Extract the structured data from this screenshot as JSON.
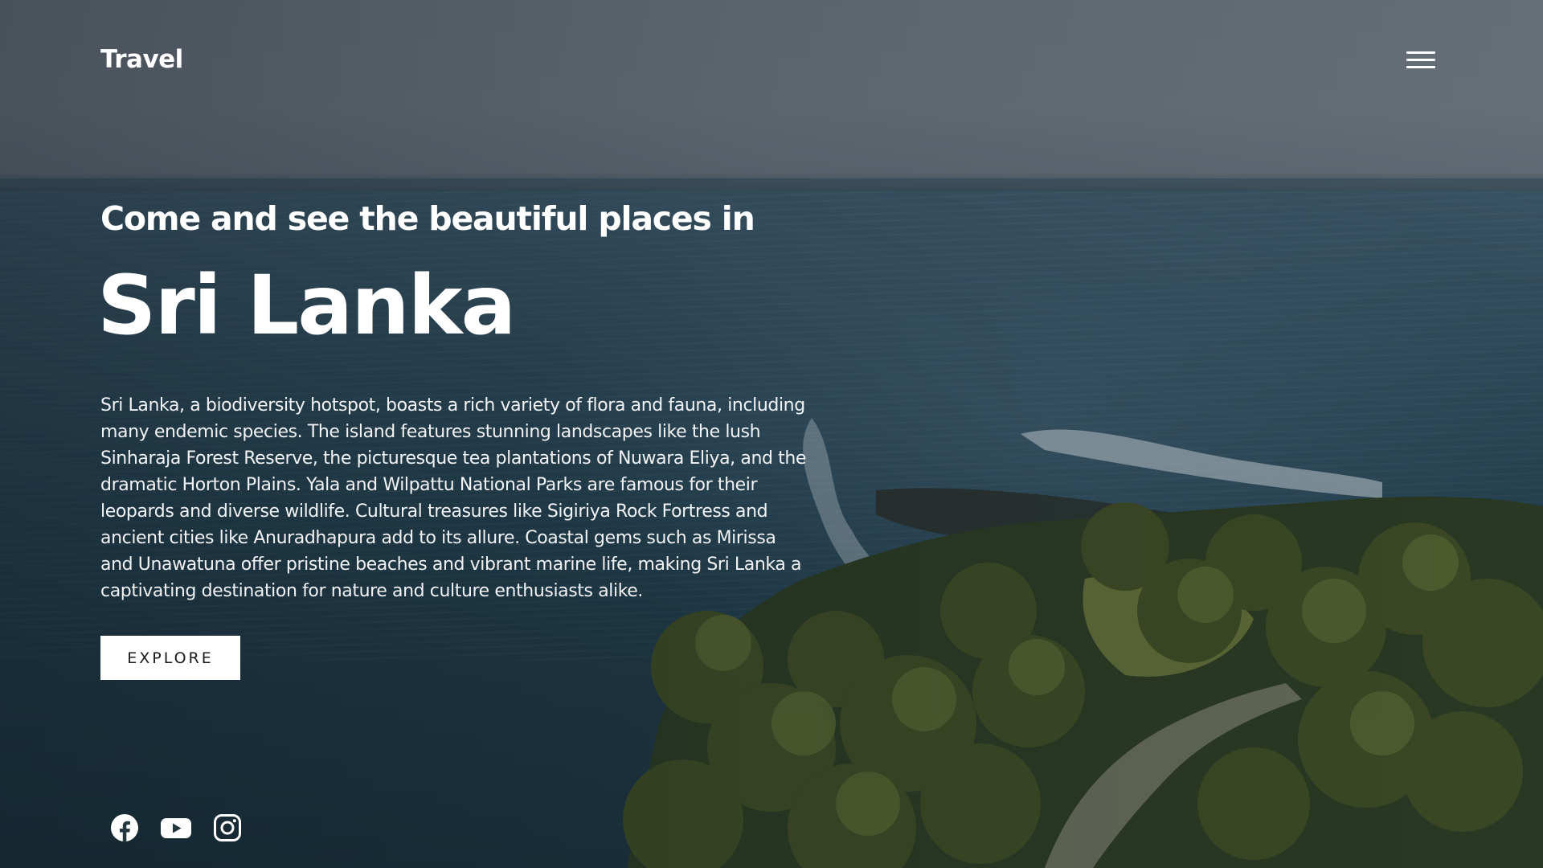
{
  "header": {
    "logo": "Travel",
    "menu_icon": "hamburger-menu-icon"
  },
  "hero": {
    "subtitle": "Come and see the beautiful places in",
    "title": "Sri Lanka",
    "description": "Sri Lanka, a biodiversity hotspot, boasts a rich variety of flora and fauna, including many endemic species. The island features stunning landscapes like the lush Sinharaja Forest Reserve, the picturesque tea plantations of Nuwara Eliya, and the dramatic Horton Plains. Yala and Wilpattu National Parks are famous for their leopards and diverse wildlife. Cultural treasures like Sigiriya Rock Fortress and ancient cities like Anuradhapura add to its allure. Coastal gems such as Mirissa and Unawatuna offer pristine beaches and vibrant marine life, making Sri Lanka a captivating destination for nature and culture enthusiasts alike.",
    "button_label": "EXPLORE"
  },
  "social": {
    "icons": [
      "facebook-icon",
      "youtube-icon",
      "instagram-icon"
    ]
  },
  "colors": {
    "text": "#ffffff",
    "button_bg": "#ffffff",
    "button_text": "#1c1c1c"
  }
}
